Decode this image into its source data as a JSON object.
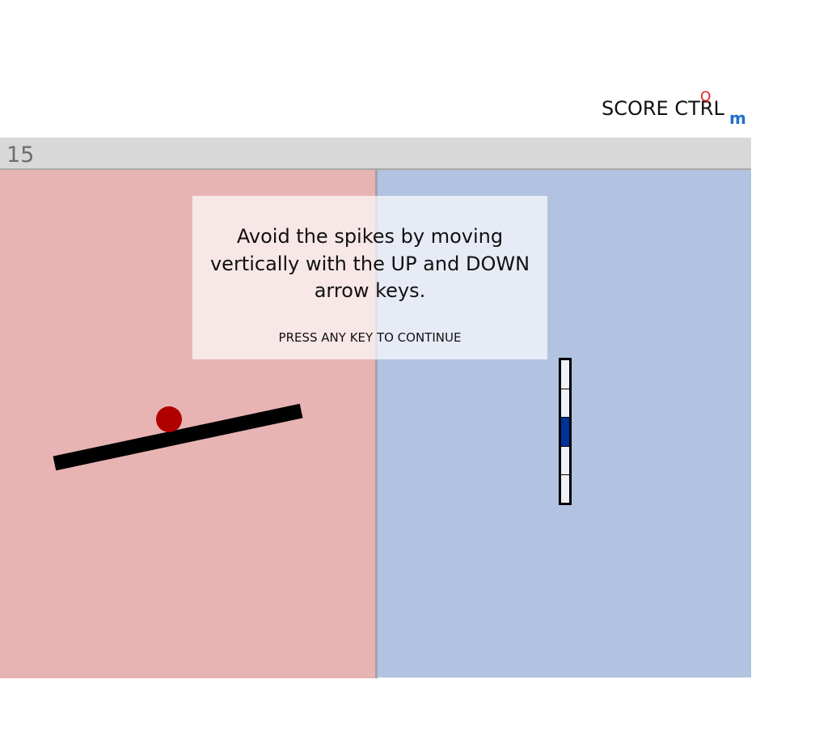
{
  "header": {
    "score_label": "SCORE CTRL",
    "q_glyph": "Q",
    "m_glyph": "m"
  },
  "status": {
    "counter": "15"
  },
  "instructions": {
    "message": "Avoid the spikes by moving vertically with the UP and DOWN arrow keys.",
    "continue_prompt": "PRESS ANY KEY TO CONTINUE"
  },
  "game": {
    "left_panel_color": "#e8b4b3",
    "right_panel_color": "#b2c2e1",
    "ball_color": "#b00000",
    "beam_color": "#000000",
    "meter": {
      "segments": 5,
      "active_segment": 3,
      "active_color": "#003399"
    }
  }
}
